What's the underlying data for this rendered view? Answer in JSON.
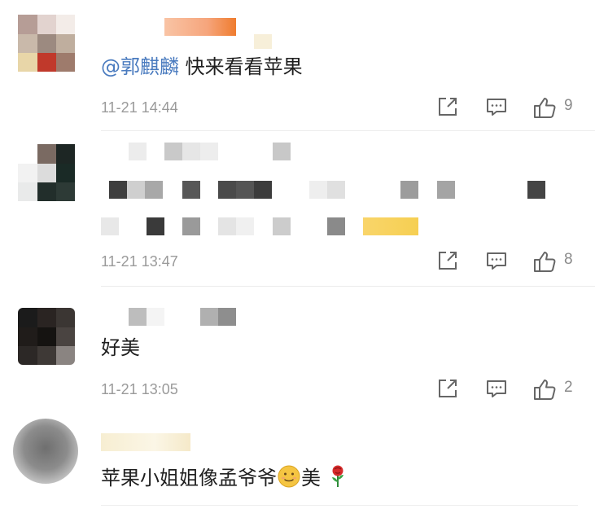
{
  "comments": [
    {
      "mention": "@郭麒麟",
      "text": " 快来看看苹果",
      "time": "11-21 14:44",
      "likes": "9"
    },
    {
      "mention": "",
      "text": "",
      "time": "11-21 13:47",
      "likes": "8"
    },
    {
      "mention": "",
      "text": "好美",
      "time": "11-21 13:05",
      "likes": "2"
    },
    {
      "mention": "",
      "text_before_emoji": "苹果小姐姐像孟爷爷",
      "text_after_emoji": "美",
      "emoji": "smiling-face",
      "time": "",
      "likes": ""
    }
  ],
  "icons": {
    "share": "share-icon",
    "reply": "comment-icon",
    "like": "thumbs-up-icon"
  },
  "colors": {
    "mention": "#4a7bbf",
    "meta": "#9a9a9a",
    "name_blur": "#f4a37a",
    "highlight_blur": "#f6cf52"
  }
}
